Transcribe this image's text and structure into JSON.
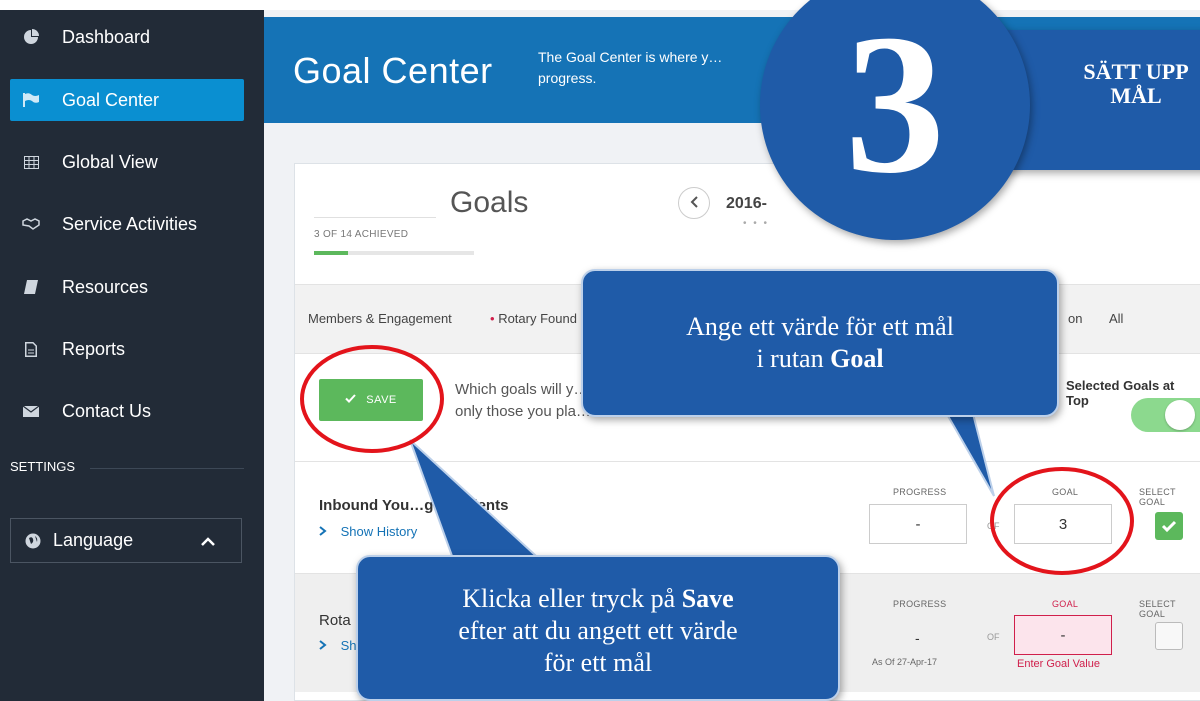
{
  "sidebar": {
    "items": [
      {
        "label": "Dashboard",
        "icon": "pie-chart-icon"
      },
      {
        "label": "Goal Center",
        "icon": "flag-icon"
      },
      {
        "label": "Global View",
        "icon": "grid-icon"
      },
      {
        "label": "Service Activities",
        "icon": "handshake-icon"
      },
      {
        "label": "Resources",
        "icon": "book-icon"
      },
      {
        "label": "Reports",
        "icon": "document-icon"
      },
      {
        "label": "Contact Us",
        "icon": "envelope-icon"
      }
    ],
    "settings_label": "SETTINGS",
    "language_label": "Language"
  },
  "header": {
    "title": "Goal Center",
    "description": "The Goal Center is where y… progress."
  },
  "goals": {
    "title": "Goals",
    "achieved": "3 OF 14 ACHIEVED",
    "achieved_fraction": 0.21,
    "period": "2016-"
  },
  "tabs": [
    "Members & Engagement",
    "Rotary Found",
    "on",
    "All"
  ],
  "save_label": "SAVE",
  "question": "Which goals will y… only those you pla…",
  "selected_top_label": "Selected Goals at Top",
  "rows": [
    {
      "name": "Inbound You…ge students",
      "show_history": "Show History",
      "progress_label": "PROGRESS",
      "goal_label": "GOAL",
      "select_label": "SELECT GOAL",
      "of_label": "OF",
      "progress_value": "-",
      "goal_value": "3",
      "selected": true
    },
    {
      "name": "Rota",
      "show_history": "Sh",
      "progress_label": "PROGRESS",
      "goal_label": "GOAL",
      "select_label": "SELECT GOAL",
      "of_label": "OF",
      "progress_value": "-",
      "goal_value": "-",
      "as_of": "As Of 27-Apr-17",
      "enter_goal": "Enter Goal Value",
      "selected": false
    }
  ],
  "overlay": {
    "step_number": "3",
    "step_title_line1": "SÄTT UPP",
    "step_title_line2": "MÅL",
    "callout_goal_line1": "Ange ett värde för ett mål",
    "callout_goal_line2_prefix": "i rutan ",
    "callout_goal_line2_bold": "Goal",
    "callout_save_line1_prefix": "Klicka eller tryck på ",
    "callout_save_line1_bold": "Save",
    "callout_save_line2": "efter att du angett ett värde",
    "callout_save_line3": "för ett mål"
  },
  "colors": {
    "sidebar_bg": "#222b37",
    "accent_blue": "#0a8fd1",
    "header_blue": "#1573b6",
    "save_green": "#5cb85c",
    "callout_blue": "#1f5ba8",
    "highlight_red": "#e3141b",
    "error_red": "#d01f4b"
  }
}
